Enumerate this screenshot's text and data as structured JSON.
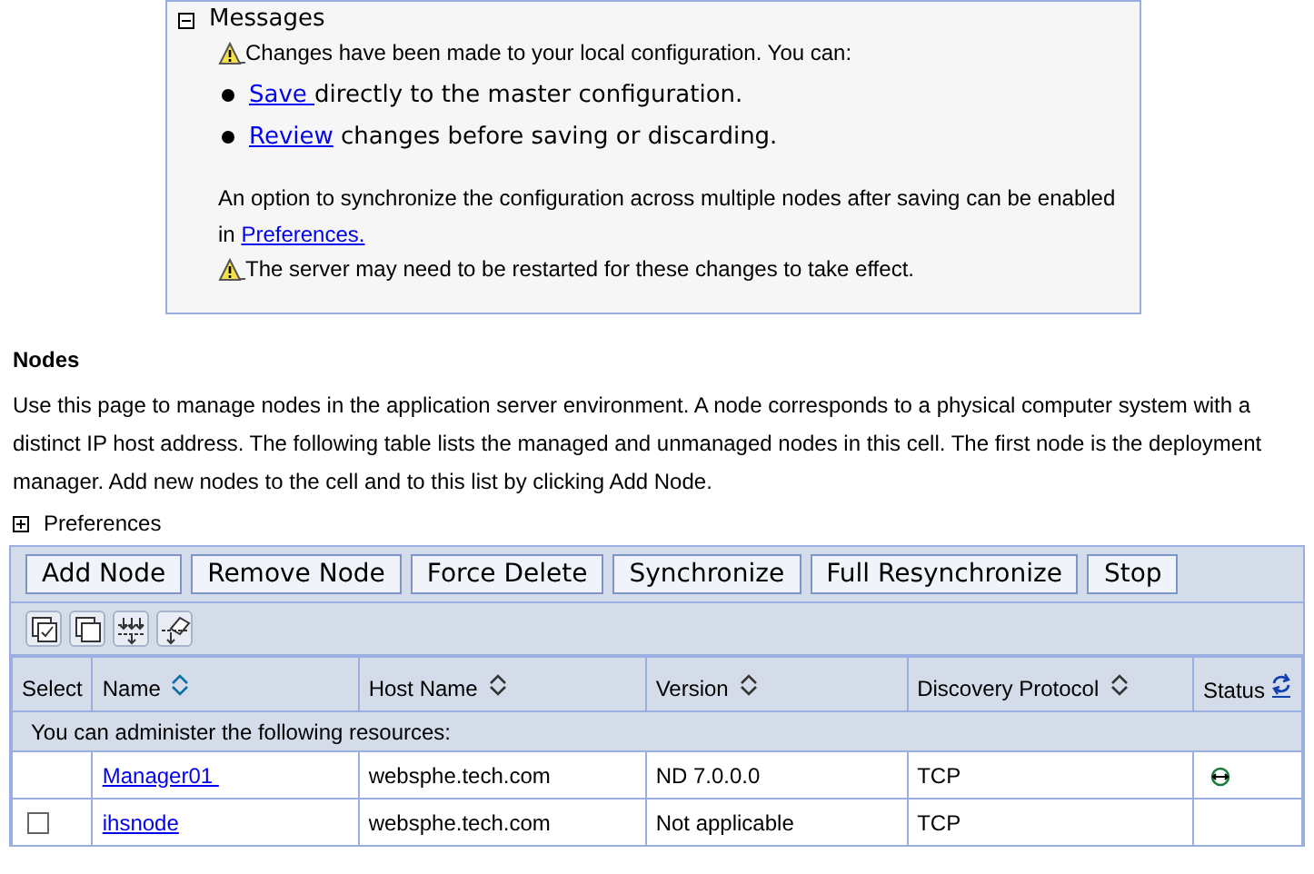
{
  "messages": {
    "title": "Messages",
    "expanded": true,
    "warning": "Changes have been made to your local configuration. You can:",
    "actions": [
      {
        "link": "Save ",
        "text": "directly to the master configuration."
      },
      {
        "link": "Review",
        "text": " changes before saving or discarding."
      }
    ],
    "sync_note": {
      "text": "An option to synchronize the configuration across multiple nodes after saving can be enabled in ",
      "link": "Preferences."
    },
    "restart_warning": "The server may need to be restarted for these changes to take effect."
  },
  "page_title": "Nodes",
  "description": "Use this page to manage nodes in the application server environment. A node corresponds to a physical computer system with a distinct IP host address. The following table lists the managed and unmanaged nodes in this cell. The first node is the deployment manager. Add new nodes to the cell and to this list by clicking Add Node.",
  "preferences": {
    "label": "Preferences",
    "expanded": false
  },
  "buttons": [
    "Add Node",
    "Remove Node",
    "Force Delete",
    "Synchronize",
    "Full Resynchronize",
    "Stop"
  ],
  "table": {
    "columns": [
      {
        "label": "Select",
        "kind": "plain"
      },
      {
        "label": "Name",
        "kind": "sorted"
      },
      {
        "label": "Host Name",
        "kind": "sortable"
      },
      {
        "label": "Version",
        "kind": "sortable"
      },
      {
        "label": "Discovery Protocol",
        "kind": "sortable"
      },
      {
        "label": "Status",
        "kind": "refresh"
      }
    ],
    "section": "You can administer the following resources:",
    "rows": [
      {
        "kind": "manager",
        "name": "Manager01 ",
        "host": "websphe.tech.com",
        "version": "ND 7.0.0.0",
        "protocol": "TCP"
      },
      {
        "kind": "node",
        "checked": false,
        "name": "ihsnode",
        "host": "websphe.tech.com",
        "version": "Not applicable",
        "protocol": "TCP"
      }
    ]
  }
}
